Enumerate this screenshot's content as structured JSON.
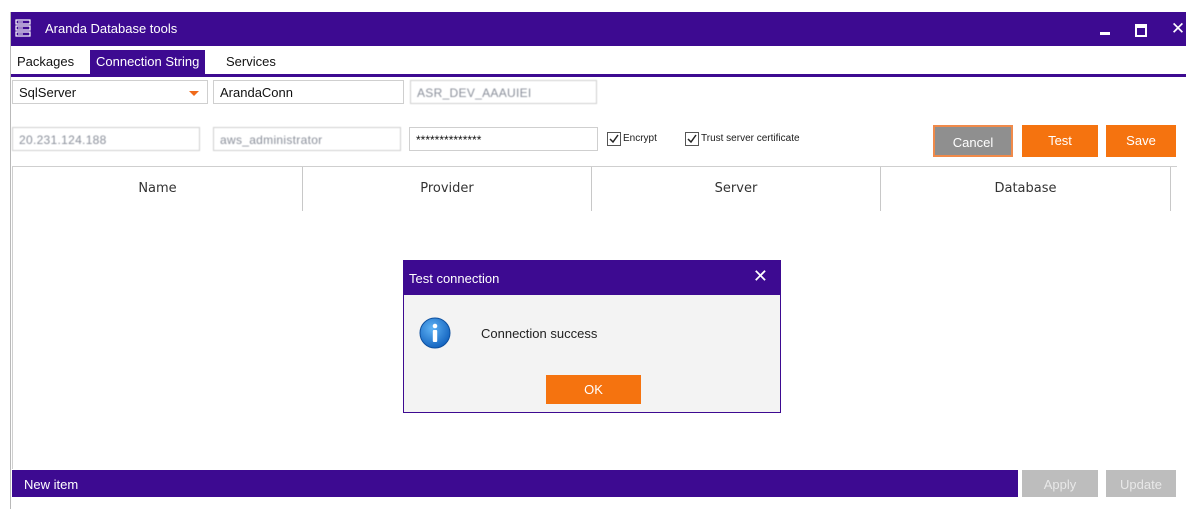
{
  "window": {
    "title": "Aranda Database tools"
  },
  "tabs": [
    {
      "label": "Packages"
    },
    {
      "label": "Connection String"
    },
    {
      "label": "Services"
    }
  ],
  "form": {
    "provider": "SqlServer",
    "connection_name": "ArandaConn",
    "database": "ASR_DEV_AAAUIEI",
    "server": "20.231.124.188",
    "username": "aws_administrator",
    "password": "**************",
    "encrypt_label": "Encrypt",
    "encrypt_checked": true,
    "trust_label": "Trust server certificate",
    "trust_checked": true
  },
  "buttons": {
    "cancel": "Cancel",
    "test": "Test",
    "save": "Save",
    "apply": "Apply",
    "update": "Update"
  },
  "grid": {
    "columns": [
      "Name",
      "Provider",
      "Server",
      "Database"
    ]
  },
  "bottom_bar": {
    "label": "New item"
  },
  "dialog": {
    "title": "Test connection",
    "message": "Connection success",
    "ok": "OK"
  },
  "colors": {
    "accent": "#3d0a91",
    "orange": "#f5730f",
    "disabled": "#bdbdbd"
  }
}
